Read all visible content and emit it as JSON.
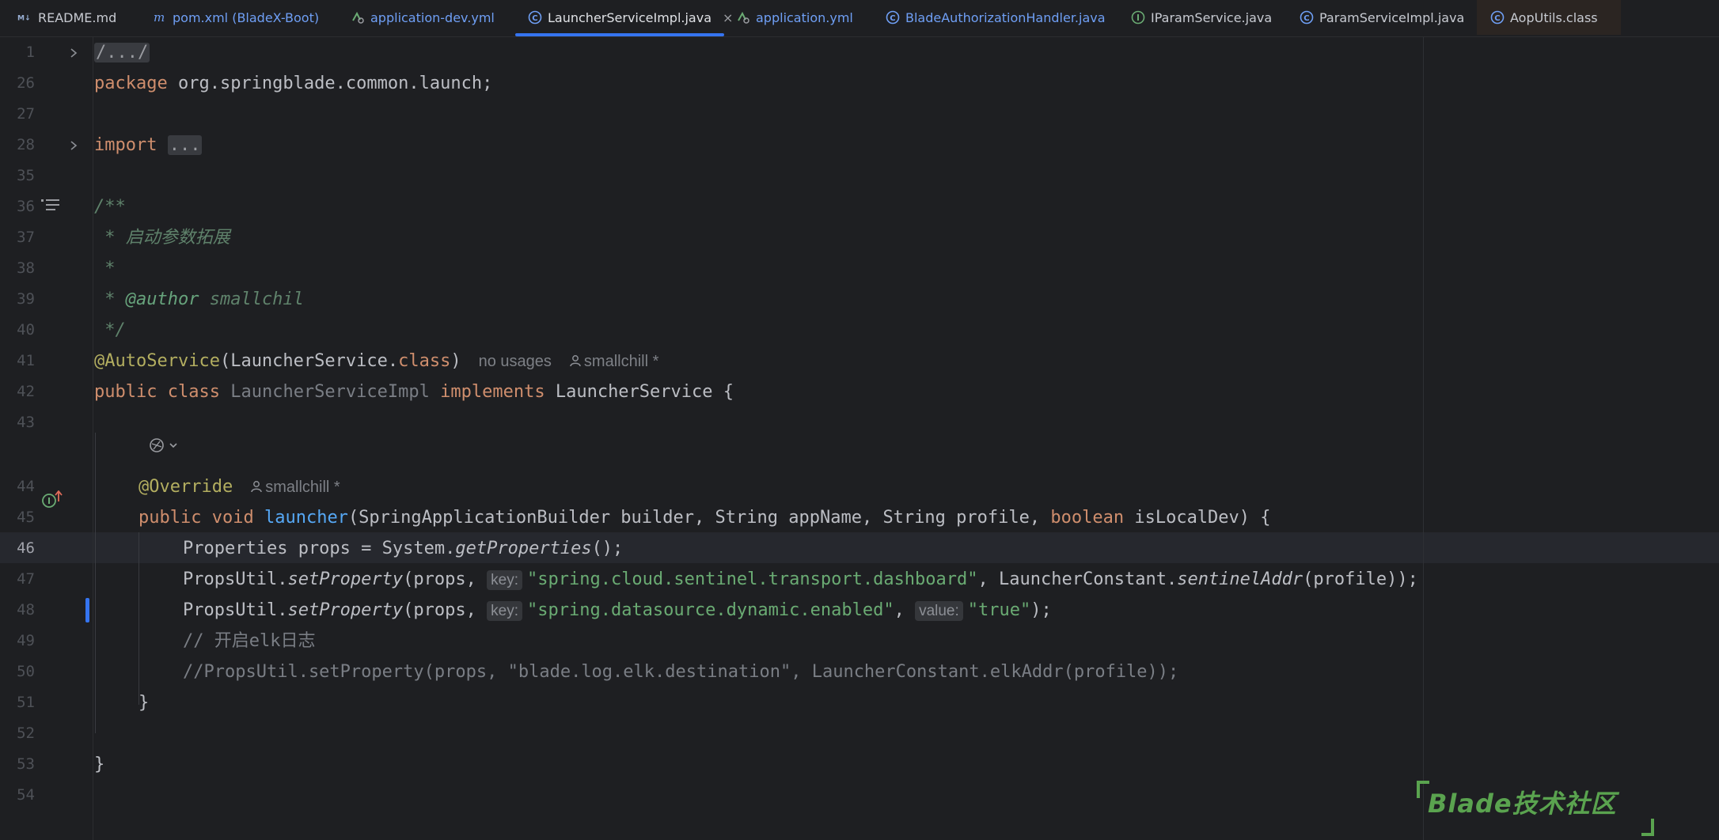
{
  "tabs": [
    {
      "label": "README.md",
      "icon": "markdown-icon"
    },
    {
      "label": "pom.xml (BladeX-Boot)",
      "icon": "maven-icon"
    },
    {
      "label": "application-dev.yml",
      "icon": "yaml-icon"
    },
    {
      "label": "LauncherServiceImpl.java",
      "icon": "class-icon",
      "active": true
    },
    {
      "label": "application.yml",
      "icon": "yaml-icon"
    },
    {
      "label": "BladeAuthorizationHandler.java",
      "icon": "class-icon"
    },
    {
      "label": "IParamService.java",
      "icon": "interface-icon"
    },
    {
      "label": "ParamServiceImpl.java",
      "icon": "class-icon"
    },
    {
      "label": "AopUtils.class",
      "icon": "class-icon"
    }
  ],
  "tab_close_glyph": "×",
  "line_numbers": [
    "1",
    "26",
    "27",
    "28",
    "35",
    "36",
    "37",
    "38",
    "39",
    "40",
    "41",
    "42",
    "43",
    "44",
    "45",
    "46",
    "47",
    "48",
    "49",
    "50",
    "51",
    "52",
    "53",
    "54"
  ],
  "code": {
    "l1": "/.../",
    "l26_kw": "package",
    "l26_rest": " org.springblade.common.launch;",
    "l28_kw": "import",
    "l28_fold": "...",
    "l36": "/**",
    "l37": " * 启动参数拓展",
    "l38": " *",
    "l39_star": " * ",
    "l39_tag": "@author",
    "l39_val": " smallchil",
    "l40": " */",
    "l41_ann": "@AutoService",
    "l41_open": "(LauncherService.",
    "l41_kw": "class",
    "l41_close": ")",
    "l41_inlay_usages": "no usages",
    "l41_inlay_author": "smallchill *",
    "l42_kw1": "public",
    "l42_kw2": "class",
    "l42_cls": "LauncherServiceImpl",
    "l42_kw3": "implements",
    "l42_rest": " LauncherService {",
    "l44_ann": "@Override",
    "l44_inlay_author": "smallchill *",
    "l45_kw1": "public",
    "l45_kw2": "void",
    "l45_fn": "launcher",
    "l45_args1": "(SpringApplicationBuilder builder, String appName, String profile, ",
    "l45_kw3": "boolean",
    "l45_args2": " isLocalDev) {",
    "l46_a": "Properties props = System.",
    "l46_fn": "getProperties",
    "l46_b": "();",
    "l47_a": "PropsUtil.",
    "l47_fn": "setProperty",
    "l47_b": "(props, ",
    "l47_hint": "key:",
    "l47_str": "\"spring.cloud.sentinel.transport.dashboard\"",
    "l47_c": ", LauncherConstant.",
    "l47_fn2": "sentinelAddr",
    "l47_d": "(profile));",
    "l48_a": "PropsUtil.",
    "l48_fn": "setProperty",
    "l48_b": "(props, ",
    "l48_hint1": "key:",
    "l48_str1": "\"spring.datasource.dynamic.enabled\"",
    "l48_c": ", ",
    "l48_hint2": "value:",
    "l48_str2": "\"true\"",
    "l48_d": ");",
    "l49": "// 开启elk日志",
    "l50": "//PropsUtil.setProperty(props, \"blade.log.elk.destination\", LauncherConstant.elkAddr(profile));",
    "l51": "}",
    "l53": "}"
  },
  "watermark": "Blade技术社区",
  "colors": {
    "background": "#1e1f22",
    "keyword": "#cf8e6d",
    "string": "#6aab73",
    "annotation": "#b3ae60",
    "function": "#56a8f5",
    "comment": "#7a7e85",
    "accent": "#3574f0"
  }
}
